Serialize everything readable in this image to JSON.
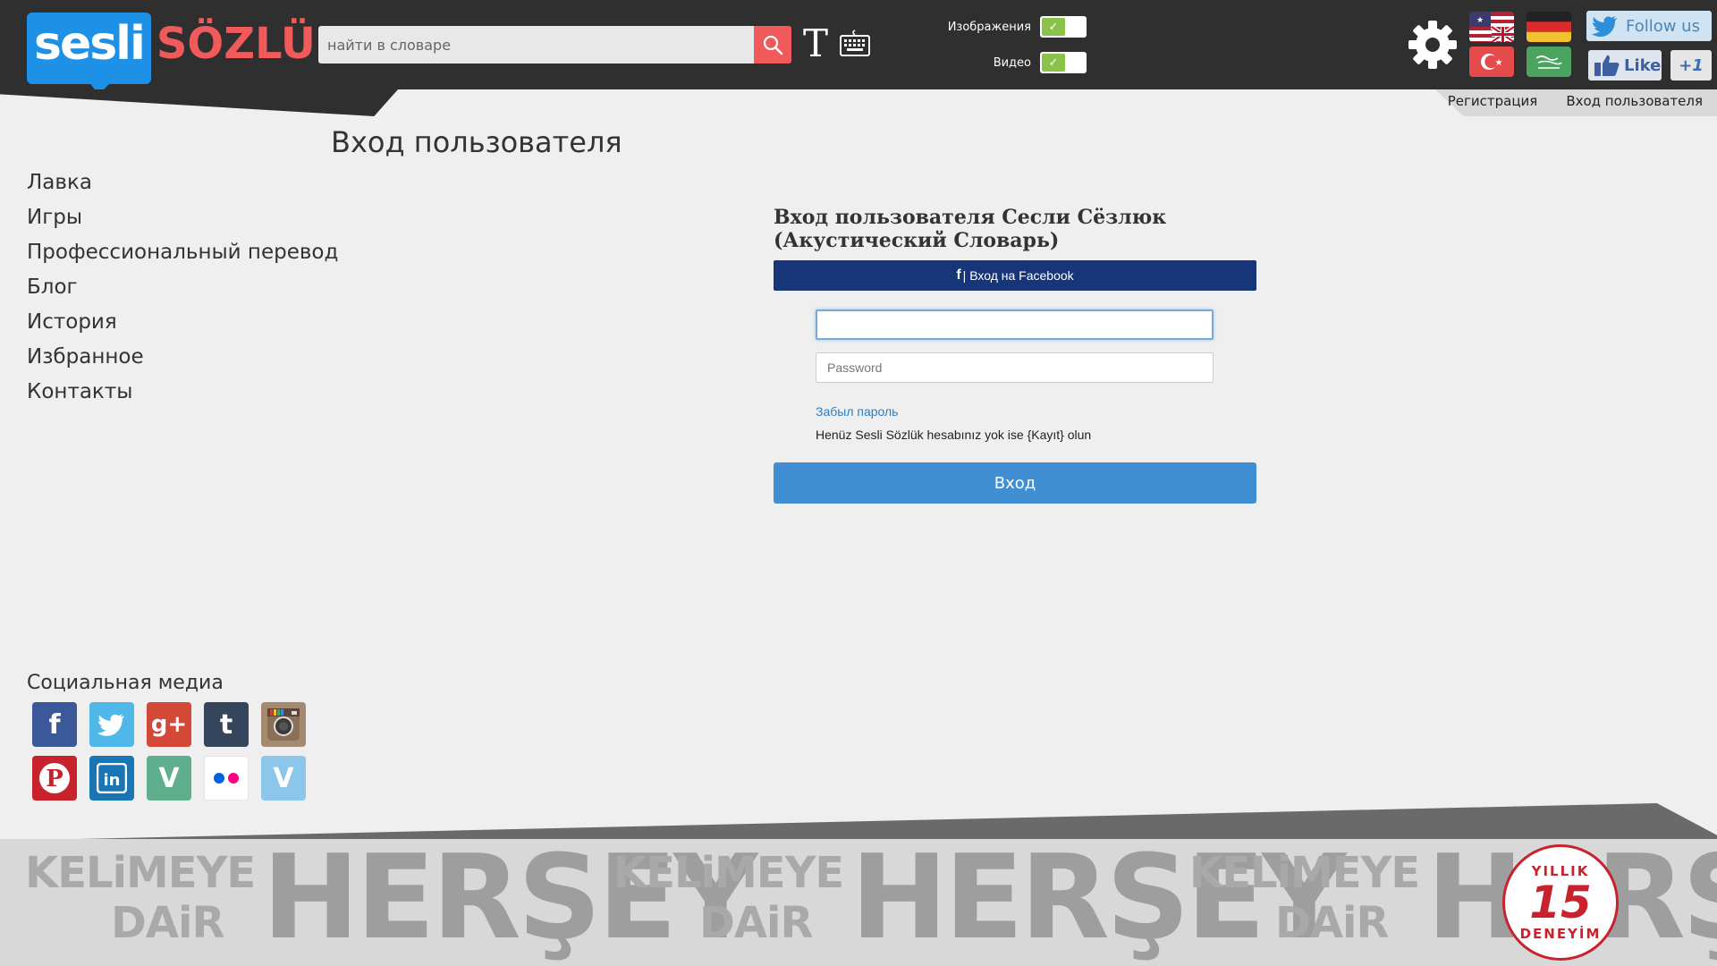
{
  "header": {
    "logo": {
      "part1": "sesli",
      "part2": "SÖZLÜK"
    },
    "search": {
      "placeholder": "найти в словаре"
    },
    "toggles": [
      {
        "label": "Изображения",
        "checked": true
      },
      {
        "label": "Видео",
        "checked": true
      }
    ],
    "social_buttons": {
      "follow_label": "Follow us",
      "like_label": "Like",
      "plus_label": "+1"
    },
    "top_links": {
      "register": "Регистрация",
      "login": "Вход пользователя"
    }
  },
  "page": {
    "title": "Вход пользователя"
  },
  "left_nav": {
    "items": [
      "Лавка",
      "Игры",
      "Профессиональный перевод",
      "Блог",
      "История",
      "Избранное",
      "Контакты"
    ]
  },
  "login": {
    "heading": "Вход пользователя Сесли Сёзлюк (Акустический Словарь)",
    "facebook_icon": "f",
    "facebook_label": "| Вход на Facebook",
    "username_value": "",
    "password_placeholder": "Password",
    "forgot_label": "Забыл пароль",
    "signup_note": "Henüz Sesli Sözlük hesabınız yok ise {Kayıt} olun",
    "submit_label": "Вход"
  },
  "social": {
    "title": "Социальная медиа",
    "icons": [
      {
        "name": "facebook-icon",
        "glyph": "f",
        "color": "#3b5998"
      },
      {
        "name": "twitter-icon",
        "glyph": "t",
        "color": "#4fb8e8"
      },
      {
        "name": "google-plus-icon",
        "glyph": "g+",
        "color": "#d34836"
      },
      {
        "name": "tumblr-icon",
        "glyph": "t",
        "color": "#35465c"
      },
      {
        "name": "instagram-icon",
        "glyph": "◉",
        "color": "#a58a71"
      },
      {
        "name": "pinterest-icon",
        "glyph": "P",
        "color": "#c8232c"
      },
      {
        "name": "linkedin-icon",
        "glyph": "in",
        "color": "#1a75b4"
      },
      {
        "name": "vine-icon",
        "glyph": "V",
        "color": "#5fae8e"
      },
      {
        "name": "flickr-icon",
        "glyph": "●●",
        "color": "#ffffff"
      },
      {
        "name": "vimeo-icon",
        "glyph": "V",
        "color": "#8cc6ea"
      }
    ]
  },
  "footer": {
    "slogan_small_1": "KELiMEYE",
    "slogan_small_2": "DAiR",
    "slogan_big": "HERŞEY",
    "badge_top": "YILLIK",
    "badge_number": "15",
    "badge_bottom": "DENEYİM"
  },
  "colors": {
    "accent_blue": "#1e90e6",
    "accent_red": "#f05a5a",
    "facebook_blue": "#173579",
    "submit_blue": "#3f8fd2"
  }
}
